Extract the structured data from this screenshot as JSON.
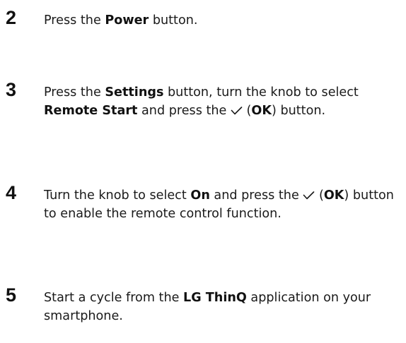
{
  "steps": [
    {
      "number": "2",
      "p1": "Press the ",
      "b1": "Power",
      "p2": " button."
    },
    {
      "number": "3",
      "p1": "Press the ",
      "b1": "Settings",
      "p2": " button, turn the knob to select ",
      "b2": "Remote Start",
      "p3": " and press the ",
      "p4": " (",
      "b3": "OK",
      "p5": ") button."
    },
    {
      "number": "4",
      "p1": "Turn the knob to select ",
      "b1": "On",
      "p2": " and press the ",
      "p3": " (",
      "b2": "OK",
      "p4": ") button to enable the remote control function."
    },
    {
      "number": "5",
      "p1": "Start a cycle from the ",
      "b1": "LG ThinQ",
      "p2": " application on your smartphone."
    }
  ],
  "icons": {
    "ok_symbol": "checkmark-icon"
  }
}
